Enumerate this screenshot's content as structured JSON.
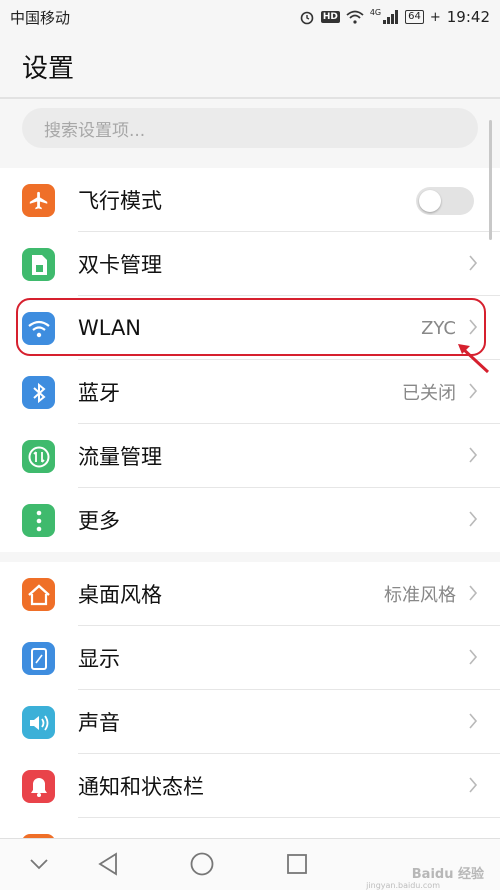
{
  "status": {
    "carrier": "中国移动",
    "time": "19:42",
    "battery": "64",
    "network": "4G",
    "hd": "HD"
  },
  "page_title": "设置",
  "search": {
    "placeholder": "搜索设置项..."
  },
  "group1": [
    {
      "label": "飞行模式",
      "value": "",
      "icon": "airplane-icon",
      "color": "#ef6f28",
      "control": "toggle",
      "toggle_on": false
    },
    {
      "label": "双卡管理",
      "value": "",
      "icon": "sim-card-icon",
      "color": "#3fba6d",
      "control": "chevron"
    },
    {
      "label": "WLAN",
      "value": "ZYC",
      "icon": "wifi-icon",
      "color": "#3e8ddf",
      "control": "chevron"
    },
    {
      "label": "蓝牙",
      "value": "已关闭",
      "icon": "bluetooth-icon",
      "color": "#3e8ddf",
      "control": "chevron"
    },
    {
      "label": "流量管理",
      "value": "",
      "icon": "data-usage-icon",
      "color": "#3fba6d",
      "control": "chevron"
    },
    {
      "label": "更多",
      "value": "",
      "icon": "more-dots-icon",
      "color": "#3fba6d",
      "control": "chevron"
    }
  ],
  "group2": [
    {
      "label": "桌面风格",
      "value": "标准风格",
      "icon": "home-icon",
      "color": "#ef6f28",
      "control": "chevron"
    },
    {
      "label": "显示",
      "value": "",
      "icon": "display-icon",
      "color": "#3e8ddf",
      "control": "chevron"
    },
    {
      "label": "声音",
      "value": "",
      "icon": "sound-icon",
      "color": "#3bb0d8",
      "control": "chevron"
    },
    {
      "label": "通知和状态栏",
      "value": "",
      "icon": "notification-icon",
      "color": "#e9434a",
      "control": "chevron"
    }
  ],
  "watermark": {
    "brand": "Baidu 经验",
    "sub": "jingyan.baidu.com"
  }
}
